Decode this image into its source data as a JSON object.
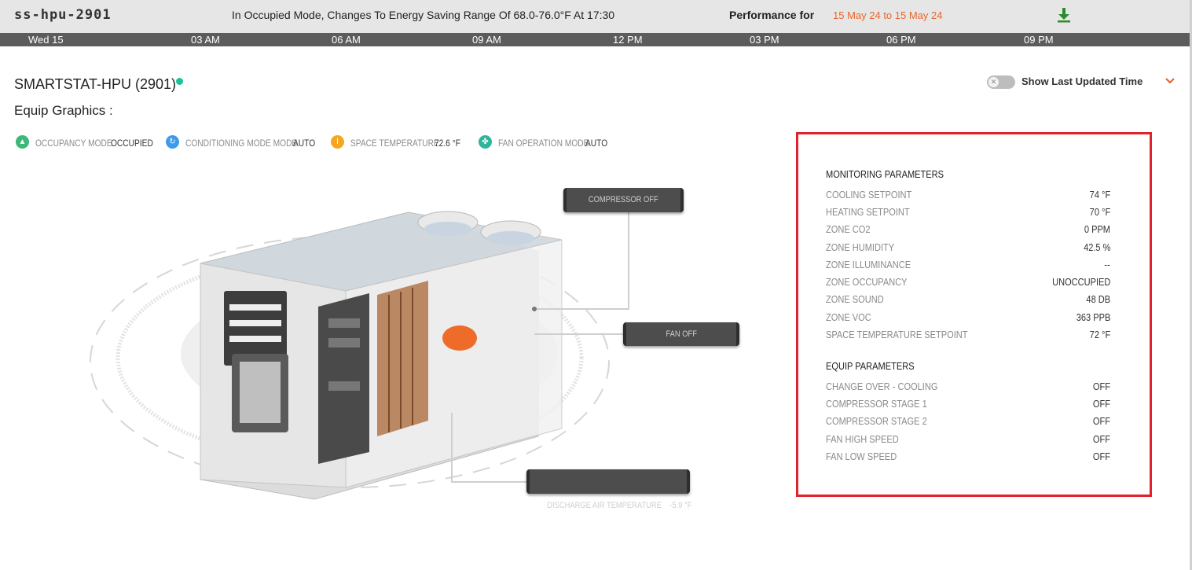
{
  "header": {
    "site_name": "ss-hpu-2901",
    "mode_message": "In Occupied Mode, Changes To Energy Saving Range Of 68.0-76.0°F At 17:30",
    "performance_label": "Performance for",
    "performance_range": "15 May 24 to 15 May 24",
    "download_icon": "download-icon"
  },
  "timeline": {
    "ticks": [
      "Wed 15",
      "03 AM",
      "06 AM",
      "09 AM",
      "12 PM",
      "03 PM",
      "06 PM",
      "09 PM"
    ]
  },
  "equip": {
    "title": "SMARTSTAT-HPU (2901)",
    "status_color": "#19c29a",
    "graphics_label": "Equip Graphics :",
    "toggle_label": "Show Last Updated Time",
    "toggle_on": false
  },
  "status_items": [
    {
      "icon": "occupancy-icon",
      "color": "#3cb878",
      "label": "OCCUPANCY MODE",
      "value": "OCCUPIED"
    },
    {
      "icon": "conditioning-icon",
      "color": "#3d9be9",
      "label": "CONDITIONING MODE MODE",
      "value": "AUTO"
    },
    {
      "icon": "thermometer-icon",
      "color": "#f5a623",
      "label": "SPACE TEMPERATURE",
      "value": "72.6 °F"
    },
    {
      "icon": "fan-icon",
      "color": "#2fb59a",
      "label": "FAN OPERATION MODE",
      "value": "AUTO"
    }
  ],
  "graphic_tags": {
    "compressor": "COMPRESSOR OFF",
    "fan": "FAN OFF",
    "discharge": "DISCHARGE AIR TEMPERATURE    -5.9 °F"
  },
  "panel": {
    "monitoring_title": "MONITORING PARAMETERS",
    "monitoring": [
      {
        "label": "COOLING SETPOINT",
        "value": "74 °F"
      },
      {
        "label": "HEATING SETPOINT",
        "value": "70 °F"
      },
      {
        "label": "ZONE CO2",
        "value": "0 PPM"
      },
      {
        "label": "ZONE HUMIDITY",
        "value": "42.5 %"
      },
      {
        "label": "ZONE ILLUMINANCE",
        "value": "--"
      },
      {
        "label": "ZONE OCCUPANCY",
        "value": "UNOCCUPIED"
      },
      {
        "label": "ZONE SOUND",
        "value": "48 DB"
      },
      {
        "label": "ZONE VOC",
        "value": "363 PPB"
      },
      {
        "label": "SPACE TEMPERATURE SETPOINT",
        "value": "72 °F"
      }
    ],
    "equip_title": "EQUIP PARAMETERS",
    "equip": [
      {
        "label": "CHANGE OVER - COOLING",
        "value": "OFF"
      },
      {
        "label": "COMPRESSOR STAGE 1",
        "value": "OFF"
      },
      {
        "label": "COMPRESSOR STAGE 2",
        "value": "OFF"
      },
      {
        "label": "FAN HIGH SPEED",
        "value": "OFF"
      },
      {
        "label": "FAN LOW SPEED",
        "value": "OFF"
      }
    ]
  },
  "colors": {
    "accent": "#e8662c",
    "panel_border": "#e0222c",
    "timeline_bg": "#5c5c5c"
  }
}
